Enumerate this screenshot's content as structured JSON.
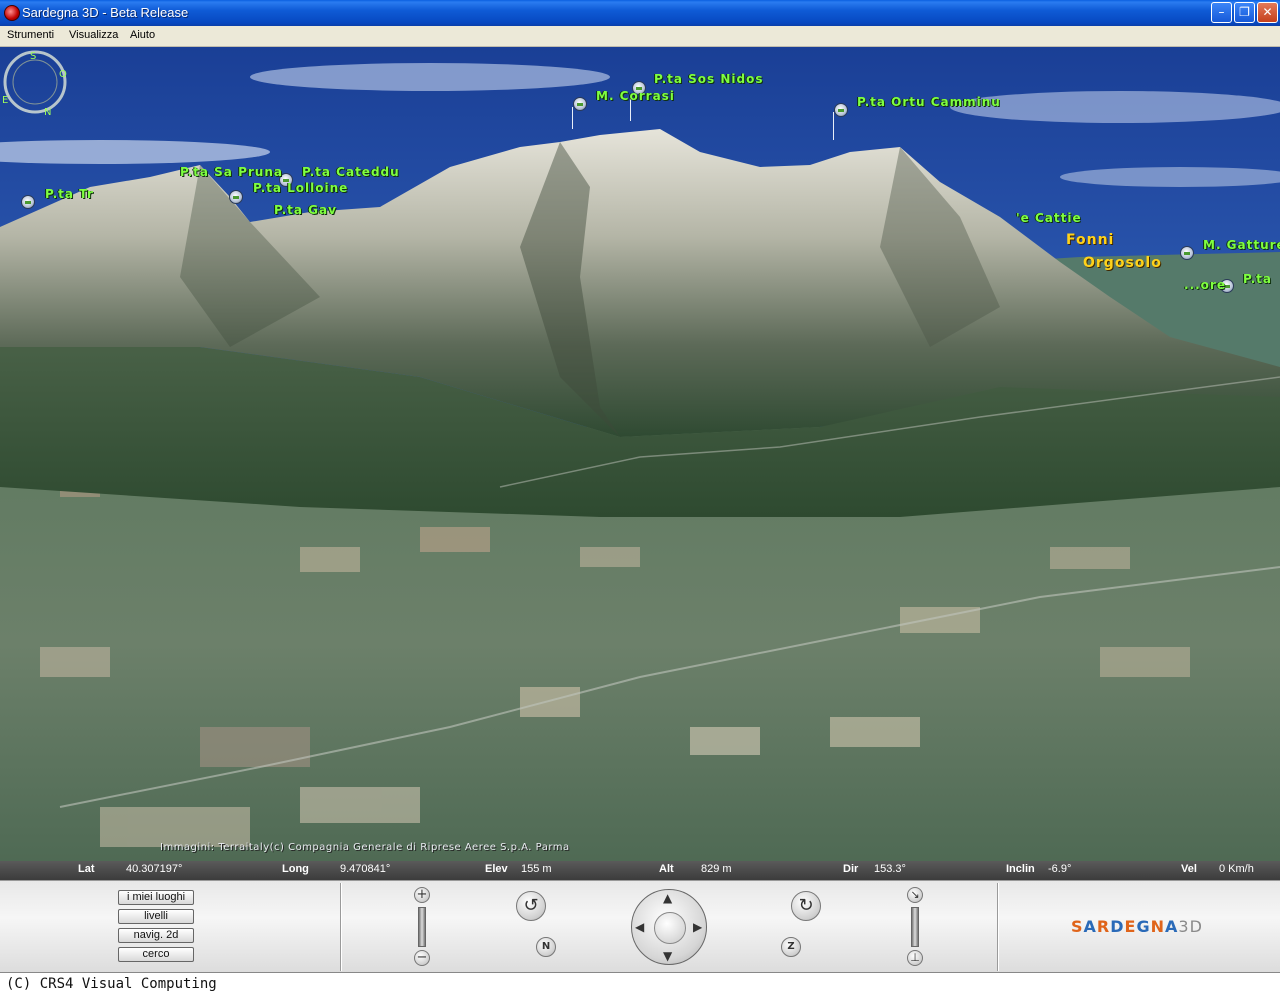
{
  "window": {
    "title": "Sardegna 3D - Beta Release"
  },
  "menu": {
    "items": [
      "Strumenti",
      "Visualizza",
      "Aiuto"
    ]
  },
  "map": {
    "peaks": [
      "P.ta Sos Nidos",
      "M. Corrasi",
      "P.ta Ortu Camminu",
      "P.ta Sa Pruna",
      "P.ta Cateddu",
      "P.ta Lolloine",
      "P.ta Tr",
      "P.ta Gav",
      "'e Cattie",
      "M. Gatture'",
      "P.ta",
      "...ore"
    ],
    "towns": [
      "Fonni",
      "Orgosolo"
    ],
    "copyright": "Immagini: Terraitaly(c) Compagnia Generale di Riprese Aeree S.p.A. Parma"
  },
  "status": {
    "lat_label": "Lat",
    "lat_value": "40.307197°",
    "long_label": "Long",
    "long_value": "9.470841°",
    "elev_label": "Elev",
    "elev_value": "155 m",
    "alt_label": "Alt",
    "alt_value": "829 m",
    "dir_label": "Dir",
    "dir_value": "153.3°",
    "inclin_label": "Inclin",
    "inclin_value": "-6.9°",
    "vel_label": "Vel",
    "vel_value": "0 Km/h"
  },
  "panel": {
    "buttons": [
      "i miei luoghi",
      "livelli",
      "navig. 2d",
      "cerco"
    ],
    "logo_main": "SARDEGNA",
    "logo_suffix": "3D",
    "icons": [
      "zoom-in-icon",
      "zoom-out-icon",
      "rotate-left-icon",
      "rotate-right-icon",
      "north-icon",
      "zenith-icon",
      "tilt-up-icon",
      "tilt-down-icon"
    ]
  },
  "footer": {
    "text": "(C) CRS4 Visual Computing"
  },
  "colors": {
    "peak_label": "#7fff40",
    "town_label": "#ffd21a",
    "titlebar": "#0a5fe0"
  }
}
